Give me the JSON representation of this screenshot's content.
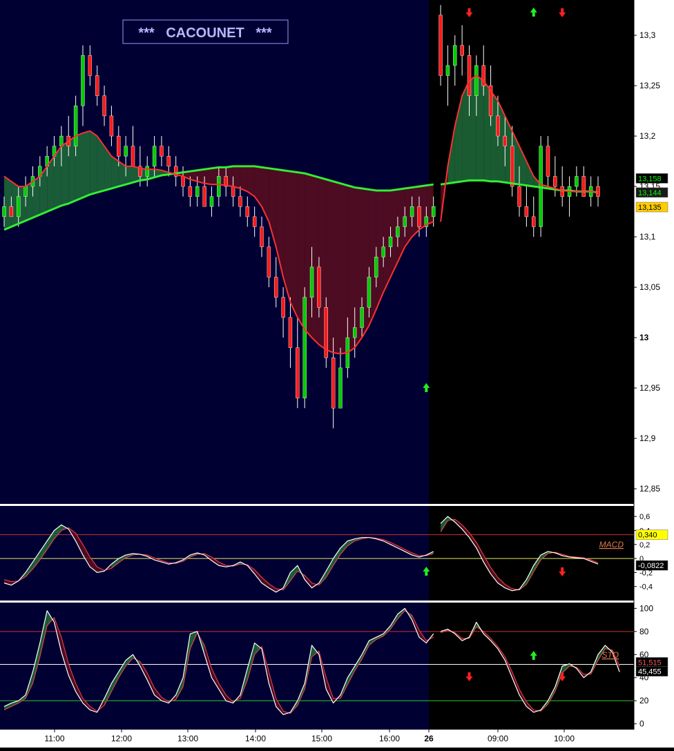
{
  "title": "***   CACOUNET   ***",
  "x_axis": {
    "ticks": [
      "11:00",
      "12:00",
      "13:00",
      "14:00",
      "15:00",
      "16:00",
      "26",
      "09:00",
      "10:00"
    ]
  },
  "colors": {
    "day1_bg": "#000033",
    "day2_bg": "#000000",
    "up": "#00cc00",
    "down": "#ff1a1a",
    "fast_ma": "#ff3030",
    "slow_ma": "#33ee33",
    "fill_up": "#1f6b3a",
    "fill_down": "#5a0e20",
    "axis_bg": "#ffffff"
  },
  "chart_data": [
    {
      "type": "candlestick",
      "name": "price",
      "ylim": [
        12.835,
        13.335
      ],
      "y_ticks": [
        "13,3",
        "13,25",
        "13,2",
        "13,15",
        "13,1",
        "13,05",
        "13",
        "12,95",
        "12,9",
        "12,85"
      ],
      "last_values": [
        "13,158",
        "13,144",
        "13,135"
      ],
      "day_break_index": 61,
      "candles": [
        [
          13.12,
          13.14,
          13.11,
          13.13
        ],
        [
          13.13,
          13.14,
          13.12,
          13.12
        ],
        [
          13.12,
          13.15,
          13.11,
          13.14
        ],
        [
          13.14,
          13.16,
          13.13,
          13.15
        ],
        [
          13.15,
          13.17,
          13.14,
          13.16
        ],
        [
          13.16,
          13.18,
          13.15,
          13.17
        ],
        [
          13.17,
          13.19,
          13.16,
          13.18
        ],
        [
          13.18,
          13.2,
          13.17,
          13.19
        ],
        [
          13.19,
          13.21,
          13.17,
          13.2
        ],
        [
          13.2,
          13.22,
          13.18,
          13.19
        ],
        [
          13.19,
          13.24,
          13.18,
          13.23
        ],
        [
          13.23,
          13.29,
          13.21,
          13.28
        ],
        [
          13.28,
          13.29,
          13.25,
          13.26
        ],
        [
          13.26,
          13.27,
          13.23,
          13.24
        ],
        [
          13.24,
          13.25,
          13.21,
          13.22
        ],
        [
          13.22,
          13.23,
          13.19,
          13.2
        ],
        [
          13.2,
          13.21,
          13.17,
          13.18
        ],
        [
          13.18,
          13.2,
          13.16,
          13.19
        ],
        [
          13.19,
          13.21,
          13.17,
          13.17
        ],
        [
          13.17,
          13.19,
          13.15,
          13.16
        ],
        [
          13.16,
          13.18,
          13.15,
          13.17
        ],
        [
          13.17,
          13.2,
          13.16,
          13.19
        ],
        [
          13.19,
          13.2,
          13.17,
          13.18
        ],
        [
          13.18,
          13.19,
          13.16,
          13.17
        ],
        [
          13.17,
          13.18,
          13.15,
          13.16
        ],
        [
          13.16,
          13.17,
          13.14,
          13.15
        ],
        [
          13.15,
          13.16,
          13.13,
          13.14
        ],
        [
          13.14,
          13.16,
          13.13,
          13.15
        ],
        [
          13.15,
          13.16,
          13.13,
          13.13
        ],
        [
          13.13,
          13.15,
          13.12,
          13.14
        ],
        [
          13.14,
          13.17,
          13.13,
          13.16
        ],
        [
          13.16,
          13.17,
          13.14,
          13.15
        ],
        [
          13.15,
          13.16,
          13.13,
          13.14
        ],
        [
          13.14,
          13.15,
          13.12,
          13.13
        ],
        [
          13.13,
          13.14,
          13.11,
          13.12
        ],
        [
          13.12,
          13.13,
          13.1,
          13.11
        ],
        [
          13.11,
          13.12,
          13.08,
          13.09
        ],
        [
          13.09,
          13.1,
          13.05,
          13.06
        ],
        [
          13.06,
          13.08,
          13.03,
          13.04
        ],
        [
          13.04,
          13.05,
          13.0,
          13.02
        ],
        [
          13.02,
          13.04,
          12.97,
          12.99
        ],
        [
          12.99,
          13.02,
          12.93,
          12.94
        ],
        [
          12.94,
          13.05,
          12.93,
          13.04
        ],
        [
          13.04,
          13.09,
          13.02,
          13.07
        ],
        [
          13.07,
          13.08,
          13.02,
          13.03
        ],
        [
          13.03,
          13.04,
          12.97,
          12.98
        ],
        [
          12.98,
          13.0,
          12.91,
          12.93
        ],
        [
          12.93,
          12.99,
          12.93,
          12.97
        ],
        [
          12.97,
          13.02,
          12.96,
          13.0
        ],
        [
          13.0,
          13.03,
          12.98,
          13.01
        ],
        [
          13.01,
          13.04,
          13.0,
          13.03
        ],
        [
          13.03,
          13.07,
          13.02,
          13.06
        ],
        [
          13.06,
          13.09,
          13.05,
          13.08
        ],
        [
          13.08,
          13.1,
          13.07,
          13.09
        ],
        [
          13.09,
          13.11,
          13.08,
          13.1
        ],
        [
          13.1,
          13.12,
          13.09,
          13.11
        ],
        [
          13.11,
          13.13,
          13.1,
          13.12
        ],
        [
          13.12,
          13.14,
          13.11,
          13.13
        ],
        [
          13.13,
          13.14,
          13.1,
          13.11
        ],
        [
          13.11,
          13.13,
          13.1,
          13.12
        ],
        [
          13.12,
          13.14,
          13.11,
          13.13
        ],
        [
          13.32,
          13.33,
          13.25,
          13.26
        ],
        [
          13.26,
          13.29,
          13.23,
          13.27
        ],
        [
          13.27,
          13.3,
          13.25,
          13.29
        ],
        [
          13.29,
          13.31,
          13.26,
          13.28
        ],
        [
          13.28,
          13.29,
          13.22,
          13.24
        ],
        [
          13.24,
          13.28,
          13.22,
          13.27
        ],
        [
          13.27,
          13.29,
          13.24,
          13.25
        ],
        [
          13.25,
          13.27,
          13.21,
          13.22
        ],
        [
          13.22,
          13.24,
          13.19,
          13.2
        ],
        [
          13.2,
          13.22,
          13.17,
          13.19
        ],
        [
          13.19,
          13.21,
          13.14,
          13.15
        ],
        [
          13.15,
          13.17,
          13.12,
          13.13
        ],
        [
          13.13,
          13.15,
          13.11,
          13.12
        ],
        [
          13.12,
          13.14,
          13.1,
          13.11
        ],
        [
          13.11,
          13.2,
          13.1,
          13.19
        ],
        [
          13.19,
          13.2,
          13.15,
          13.16
        ],
        [
          13.16,
          13.18,
          13.14,
          13.15
        ],
        [
          13.15,
          13.17,
          13.13,
          13.14
        ],
        [
          13.14,
          13.16,
          13.12,
          13.15
        ],
        [
          13.15,
          13.17,
          13.14,
          13.16
        ],
        [
          13.16,
          13.17,
          13.14,
          13.14
        ],
        [
          13.14,
          13.16,
          13.13,
          13.15
        ],
        [
          13.15,
          13.16,
          13.13,
          13.14
        ]
      ],
      "fast_ma": [
        13.16,
        13.155,
        13.15,
        13.15,
        13.155,
        13.16,
        13.17,
        13.18,
        13.19,
        13.195,
        13.2,
        13.203,
        13.205,
        13.2,
        13.19,
        13.18,
        13.175,
        13.17,
        13.17,
        13.168,
        13.167,
        13.167,
        13.166,
        13.164,
        13.162,
        13.16,
        13.157,
        13.155,
        13.153,
        13.152,
        13.152,
        13.151,
        13.15,
        13.148,
        13.145,
        13.14,
        13.13,
        13.115,
        13.09,
        13.06,
        13.035,
        13.02,
        13.008,
        13.0,
        12.993,
        12.988,
        12.985,
        12.984,
        12.985,
        12.99,
        13.0,
        13.012,
        13.028,
        13.045,
        13.06,
        13.075,
        13.09,
        13.1,
        13.107,
        13.112,
        13.115,
        13.115,
        13.17,
        13.21,
        13.24,
        13.255,
        13.26,
        13.255,
        13.245,
        13.235,
        13.22,
        13.205,
        13.19,
        13.175,
        13.16,
        13.152,
        13.15,
        13.148,
        13.146,
        13.145,
        13.145,
        13.145,
        13.145,
        13.144
      ],
      "slow_ma": [
        13.107,
        13.11,
        13.113,
        13.116,
        13.119,
        13.122,
        13.125,
        13.128,
        13.131,
        13.133,
        13.136,
        13.139,
        13.142,
        13.144,
        13.146,
        13.148,
        13.15,
        13.152,
        13.154,
        13.156,
        13.157,
        13.159,
        13.161,
        13.162,
        13.163,
        13.164,
        13.165,
        13.166,
        13.167,
        13.168,
        13.169,
        13.169,
        13.17,
        13.17,
        13.17,
        13.17,
        13.169,
        13.168,
        13.167,
        13.166,
        13.165,
        13.164,
        13.163,
        13.161,
        13.159,
        13.157,
        13.155,
        13.153,
        13.151,
        13.149,
        13.148,
        13.147,
        13.146,
        13.146,
        13.146,
        13.147,
        13.148,
        13.149,
        13.15,
        13.151,
        13.152,
        13.152,
        13.153,
        13.154,
        13.155,
        13.156,
        13.156,
        13.156,
        13.155,
        13.155,
        13.154,
        13.153,
        13.152,
        13.151,
        13.15,
        13.149,
        13.148,
        13.147,
        13.146,
        13.146,
        13.145,
        13.145,
        13.145,
        13.144
      ],
      "signals": [
        {
          "i": 65,
          "dir": "down",
          "pos": "top"
        },
        {
          "i": 74,
          "dir": "up",
          "pos": "top"
        },
        {
          "i": 78,
          "dir": "down",
          "pos": "top"
        },
        {
          "i": 59,
          "dir": "up",
          "pos": "bottom"
        }
      ]
    },
    {
      "type": "line",
      "name": "MACD",
      "label": "MACD",
      "ylim": [
        -0.6,
        0.75
      ],
      "y_ticks": [
        "0,6",
        "0,4",
        "0,2",
        "0",
        "-0,2",
        "-0,4"
      ],
      "levels": [
        0.34,
        0
      ],
      "last_values": [
        "0,340",
        "-0,0822"
      ],
      "macd": [
        -0.35,
        -0.38,
        -0.32,
        -0.2,
        -0.05,
        0.1,
        0.25,
        0.4,
        0.48,
        0.42,
        0.25,
        0.05,
        -0.12,
        -0.2,
        -0.18,
        -0.08,
        0.0,
        0.05,
        0.07,
        0.06,
        0.03,
        -0.02,
        -0.05,
        -0.08,
        -0.06,
        -0.02,
        0.05,
        0.08,
        0.05,
        -0.03,
        -0.1,
        -0.12,
        -0.1,
        -0.05,
        -0.1,
        -0.22,
        -0.35,
        -0.42,
        -0.48,
        -0.42,
        -0.2,
        -0.1,
        -0.3,
        -0.42,
        -0.35,
        -0.18,
        0.0,
        0.15,
        0.25,
        0.28,
        0.3,
        0.3,
        0.28,
        0.25,
        0.2,
        0.15,
        0.1,
        0.05,
        0.02,
        0.05,
        0.1,
        0.5,
        0.6,
        0.52,
        0.42,
        0.3,
        0.15,
        -0.05,
        -0.22,
        -0.35,
        -0.42,
        -0.46,
        -0.44,
        -0.3,
        -0.1,
        0.05,
        0.1,
        0.08,
        0.04,
        0.02,
        0.01,
        0.0,
        -0.04,
        -0.08
      ],
      "signal": [
        -0.3,
        -0.33,
        -0.32,
        -0.26,
        -0.15,
        -0.02,
        0.13,
        0.28,
        0.4,
        0.44,
        0.36,
        0.2,
        0.02,
        -0.12,
        -0.17,
        -0.14,
        -0.06,
        0.01,
        0.05,
        0.06,
        0.05,
        0.01,
        -0.03,
        -0.06,
        -0.07,
        -0.04,
        0.02,
        0.06,
        0.07,
        0.02,
        -0.05,
        -0.1,
        -0.11,
        -0.08,
        -0.09,
        -0.16,
        -0.27,
        -0.36,
        -0.43,
        -0.45,
        -0.32,
        -0.18,
        -0.24,
        -0.35,
        -0.38,
        -0.27,
        -0.1,
        0.06,
        0.18,
        0.25,
        0.28,
        0.3,
        0.29,
        0.27,
        0.23,
        0.18,
        0.13,
        0.08,
        0.04,
        0.04,
        0.07,
        0.38,
        0.54,
        0.56,
        0.48,
        0.37,
        0.23,
        0.05,
        -0.13,
        -0.27,
        -0.37,
        -0.43,
        -0.45,
        -0.37,
        -0.19,
        -0.02,
        0.07,
        0.09,
        0.06,
        0.03,
        0.02,
        0.01,
        -0.02,
        -0.06
      ],
      "signals": [
        {
          "i": 59,
          "dir": "up"
        },
        {
          "i": 78,
          "dir": "down"
        }
      ]
    },
    {
      "type": "line",
      "name": "STO",
      "label": "STO",
      "ylim": [
        -5,
        105
      ],
      "y_ticks": [
        "100",
        "80",
        "60",
        "40",
        "20",
        "0"
      ],
      "levels": [
        80,
        51.515,
        20
      ],
      "last_values": [
        "51,515",
        "45,455"
      ],
      "k": [
        15,
        18,
        20,
        25,
        45,
        70,
        98,
        88,
        62,
        42,
        28,
        18,
        12,
        10,
        22,
        35,
        45,
        55,
        60,
        50,
        38,
        25,
        20,
        18,
        25,
        40,
        78,
        80,
        60,
        40,
        30,
        20,
        18,
        25,
        48,
        70,
        65,
        35,
        15,
        8,
        10,
        20,
        35,
        68,
        60,
        30,
        18,
        25,
        40,
        50,
        60,
        72,
        75,
        78,
        85,
        95,
        100,
        90,
        75,
        70,
        78,
        80,
        82,
        78,
        72,
        75,
        88,
        78,
        72,
        65,
        55,
        40,
        25,
        15,
        10,
        12,
        20,
        32,
        50,
        52,
        48,
        40,
        45,
        60,
        68,
        62,
        45
      ],
      "d": [
        12,
        15,
        18,
        22,
        35,
        58,
        85,
        92,
        75,
        52,
        35,
        22,
        15,
        11,
        16,
        28,
        40,
        50,
        57,
        54,
        44,
        31,
        23,
        19,
        21,
        32,
        65,
        79,
        68,
        48,
        35,
        25,
        19,
        22,
        38,
        60,
        67,
        45,
        22,
        11,
        9,
        16,
        30,
        58,
        63,
        40,
        22,
        22,
        34,
        46,
        56,
        68,
        73,
        76,
        82,
        91,
        98,
        94,
        81,
        72,
        75,
        79,
        81,
        79,
        74,
        74,
        84,
        80,
        74,
        67,
        58,
        45,
        30,
        19,
        12,
        11,
        17,
        28,
        44,
        50,
        49,
        43,
        43,
        55,
        65,
        64,
        50
      ],
      "signals": [
        {
          "i": 65,
          "dir": "down"
        },
        {
          "i": 74,
          "dir": "up"
        },
        {
          "i": 78,
          "dir": "down"
        }
      ]
    }
  ]
}
